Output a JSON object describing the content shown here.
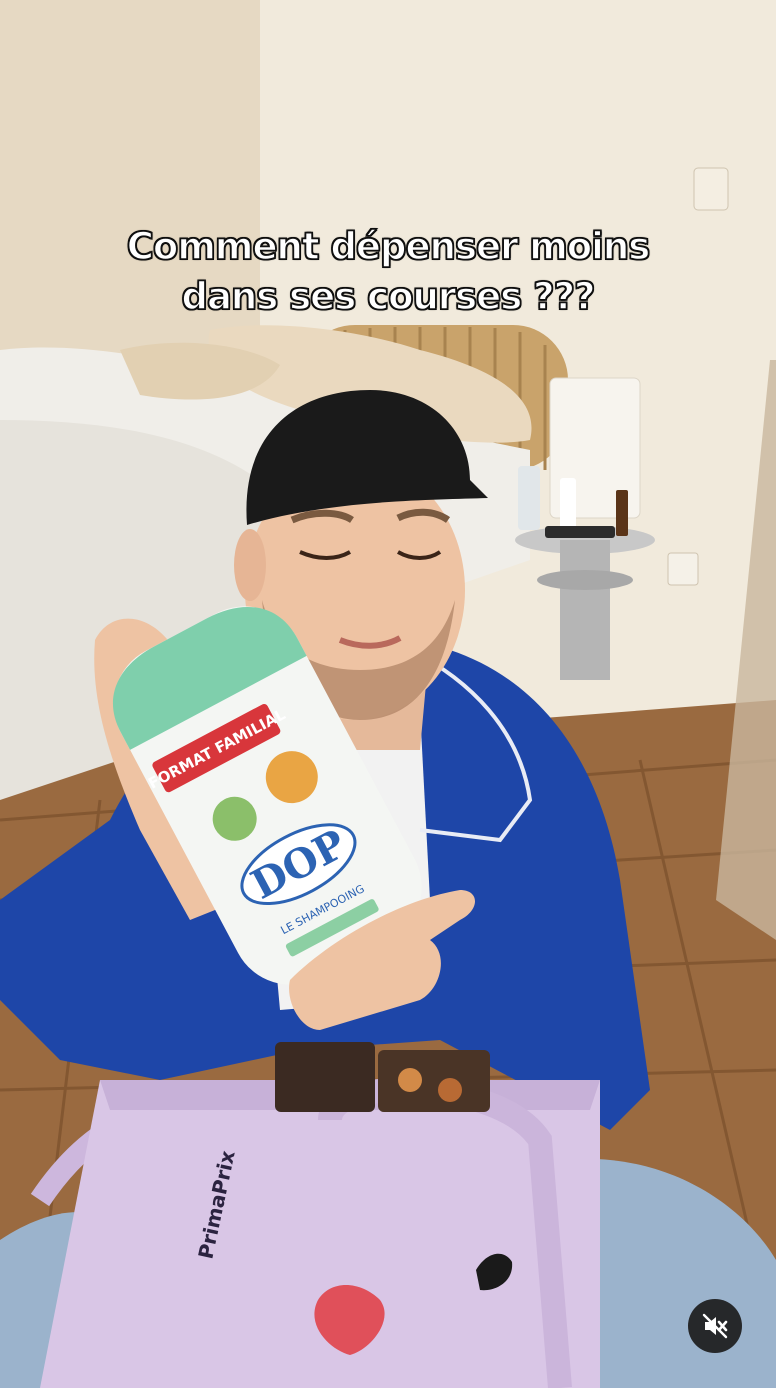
{
  "overlay": {
    "caption_lines": [
      "Comment dépenser moins",
      "dans ses courses ???"
    ]
  },
  "product": {
    "brand": "DOP",
    "badge": "FORMAT FAMILIAL",
    "subtitle": "LE SHAMPOOING"
  },
  "bag": {
    "brand": "PrimaPrix"
  },
  "controls": {
    "mute_icon": "speaker-muted-icon",
    "mute_state": "muted"
  },
  "colors": {
    "jacket": "#1e46a8",
    "bag": "#d9c6e6",
    "cap": "#1a1a1a",
    "wall": "#ece3d2",
    "floor": "#9a6a40"
  }
}
